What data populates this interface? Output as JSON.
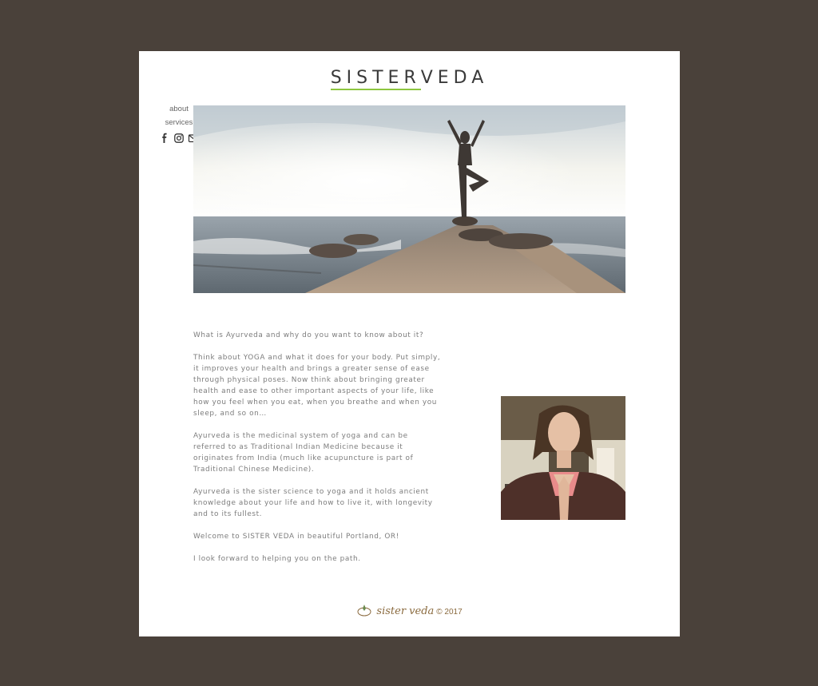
{
  "brand": {
    "logo_part1": "SISTER",
    "logo_part2": "VEDA",
    "accent_color": "#8dc63f"
  },
  "nav": {
    "about": "about",
    "services": "services",
    "social_icons": [
      "facebook-icon",
      "instagram-icon",
      "email-icon"
    ]
  },
  "content": {
    "paragraphs": [
      "What is Ayurveda and why do you want to know about it?",
      "Think about YOGA and what it does for your body. Put simply, it improves your health and brings a greater sense of ease through physical poses. Now think about bringing greater health and ease to other important aspects of your life, like how you feel when you eat, when you breathe and when you sleep, and so on…",
      "Ayurveda is the medicinal system of yoga and can be referred to as Traditional Indian Medicine because it originates from India (much like acupuncture is part of Traditional Chinese Medicine).",
      "Ayurveda is the sister science to yoga and it holds ancient knowledge about your life and how to live it, with longevity and to its fullest.",
      "Welcome to SISTER VEDA in beautiful Portland, OR!",
      "I look forward to helping you on the path."
    ]
  },
  "footer": {
    "brand": "sister veda",
    "copyright": "© 2017"
  }
}
